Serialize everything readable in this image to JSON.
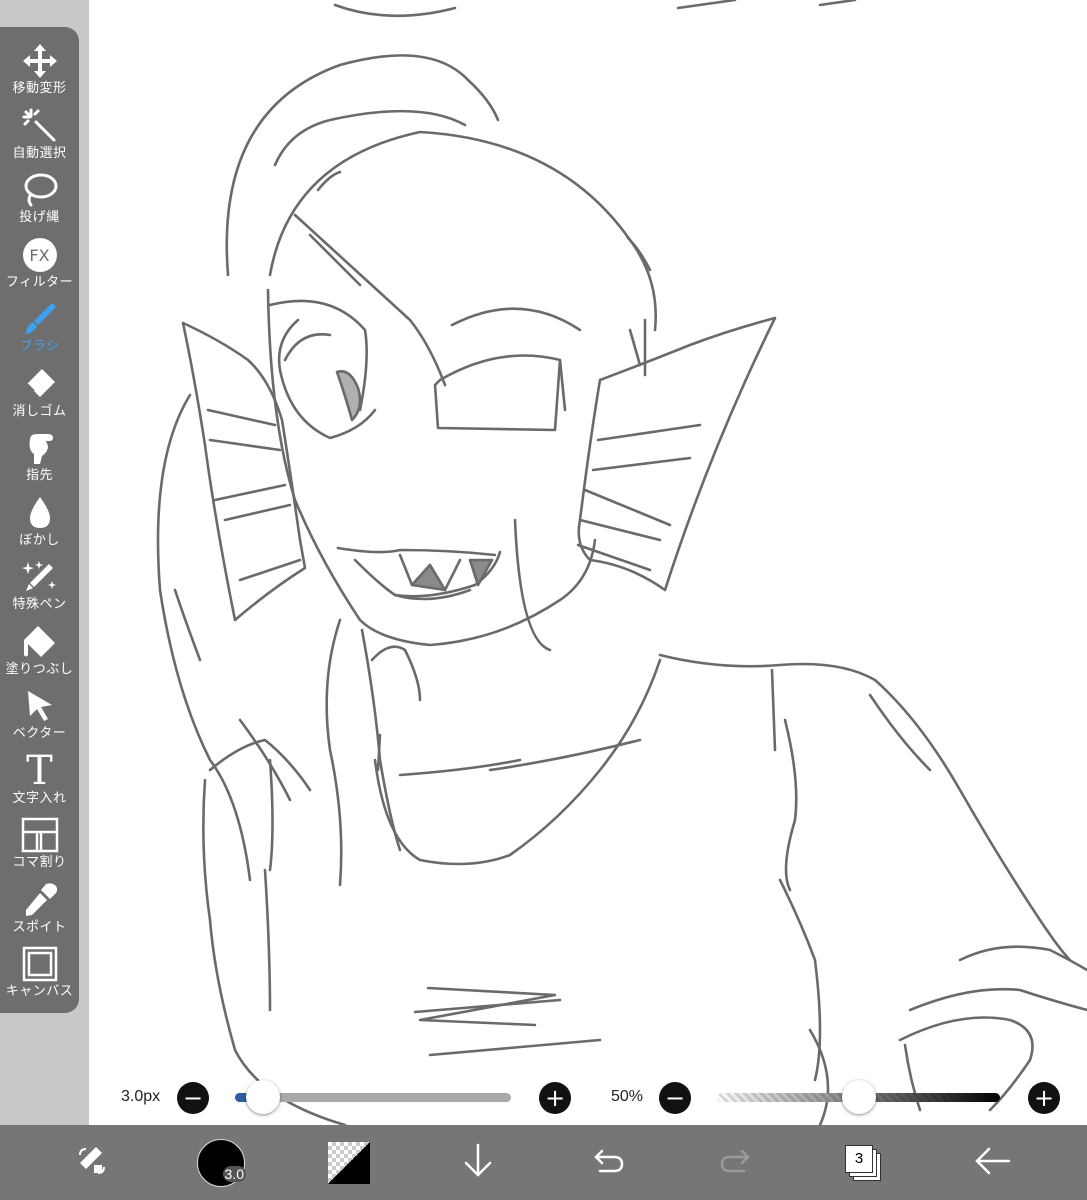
{
  "toolbar": {
    "tools": [
      {
        "id": "transform",
        "label": "移動変形",
        "icon": "move-arrows-icon"
      },
      {
        "id": "magic-wand",
        "label": "自動選択",
        "icon": "magic-wand-icon"
      },
      {
        "id": "lasso",
        "label": "投げ縄",
        "icon": "lasso-icon"
      },
      {
        "id": "filter",
        "label": "フィルター",
        "icon": "fx-icon",
        "icon_text": "FX"
      },
      {
        "id": "brush",
        "label": "ブラシ",
        "icon": "brush-icon",
        "active": true
      },
      {
        "id": "eraser",
        "label": "消しゴム",
        "icon": "eraser-icon"
      },
      {
        "id": "finger",
        "label": "指先",
        "icon": "finger-icon"
      },
      {
        "id": "blur",
        "label": "ぼかし",
        "icon": "drop-icon"
      },
      {
        "id": "special-pen",
        "label": "特殊ペン",
        "icon": "sparkle-pen-icon"
      },
      {
        "id": "fill",
        "label": "塗りつぶし",
        "icon": "fill-bucket-icon"
      },
      {
        "id": "vector",
        "label": "ベクター",
        "icon": "cursor-arrow-icon"
      },
      {
        "id": "text",
        "label": "文字入れ",
        "icon": "text-t-icon",
        "icon_text": "T"
      },
      {
        "id": "frame",
        "label": "コマ割り",
        "icon": "frame-divider-icon"
      },
      {
        "id": "eyedropper",
        "label": "スポイト",
        "icon": "eyedropper-icon"
      },
      {
        "id": "canvas",
        "label": "キャンバス",
        "icon": "canvas-icon"
      }
    ],
    "active_color": "#3ea0f0"
  },
  "brush_size": {
    "value_label": "3.0px",
    "minus": "−",
    "plus": "+",
    "level": 0.1
  },
  "opacity": {
    "value_label": "50%",
    "minus": "−",
    "plus": "+",
    "level": 0.5
  },
  "bottom_bar": {
    "brush_indicator": "3.0",
    "layer_count": "3",
    "icons": [
      "swap-tool-icon",
      "brush-size-indicator",
      "color-swatch",
      "down-arrow-icon",
      "undo-icon",
      "redo-icon",
      "layers-icon",
      "back-arrow-icon"
    ]
  },
  "colors": {
    "toolbar_bg": "#6e6e6e",
    "bottom_bar_bg": "#767676",
    "canvas_bg": "#ffffff",
    "sketch_stroke": "#6a6a6a",
    "accent": "#3ea0f0"
  }
}
